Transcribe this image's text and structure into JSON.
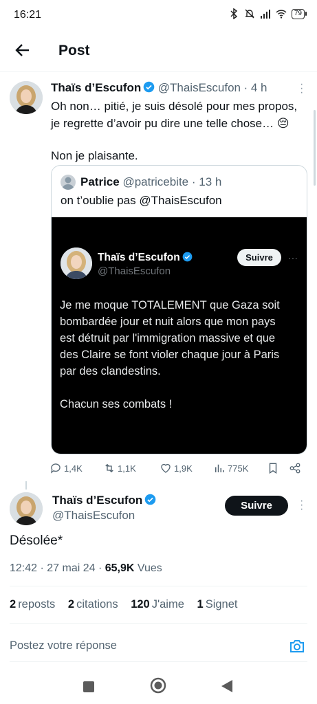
{
  "status_bar": {
    "time": "16:21",
    "battery": "79"
  },
  "header": {
    "title": "Post"
  },
  "reply_tweet": {
    "author_name": "Thaïs d’Escufon",
    "handle": "@ThaisEscufon",
    "time": "· 4 h",
    "text_line1": "Oh non… pitié, je suis désolé pour mes propos,",
    "text_line2": "je regrette d’avoir pu dire une telle chose… 😔",
    "text_line3": "Non je plaisante.",
    "quote": {
      "author_name": "Patrice",
      "handle": "@patricebite",
      "time": "· 13 h",
      "text": "on t’oublie pas @ThaisEscufon",
      "image": {
        "name": "Thaïs d’Escufon",
        "handle": "@ThaisEscufon",
        "follow_label": "Suivre",
        "body_lines": [
          "Je me moque TOTALEMENT que Gaza soit",
          "bombardée jour et nuit alors que mon pays",
          "est détruit par l'immigration massive et que",
          "des Claire se font violer chaque jour à Paris",
          "par des clandestins."
        ],
        "closing": "Chacun ses combats !"
      }
    },
    "actions": {
      "replies": "1,4K",
      "reposts": "1,1K",
      "likes": "1,9K",
      "views": "775K"
    }
  },
  "main_tweet": {
    "author_name": "Thaïs d’Escufon",
    "handle": "@ThaisEscufon",
    "follow_label": "Suivre",
    "text": "Désolée*",
    "timestamp": "12:42 · 27 mai 24 · ",
    "views_count": "65,9K",
    "views_label": " Vues",
    "stats": {
      "reposts_count": "2",
      "reposts_label": "reposts",
      "quotes_count": "2",
      "quotes_label": "citations",
      "likes_count": "120",
      "likes_label": "J'aime",
      "bookmarks_count": "1",
      "bookmarks_label": "Signet"
    }
  },
  "reply_box": {
    "placeholder": "Postez votre réponse"
  },
  "icons": {
    "bluetooth": "bluetooth-icon",
    "mute": "mute-icon",
    "signal": "signal-icon",
    "wifi": "wifi-icon",
    "back": "back-arrow-icon",
    "verified": "verified-badge-icon",
    "reply": "reply-icon",
    "repost": "repost-icon",
    "like": "heart-icon",
    "views": "views-chart-icon",
    "bookmark": "bookmark-icon",
    "share": "share-icon",
    "camera": "camera-icon"
  },
  "colors": {
    "verified": "#1d9bf0",
    "text": "#0f1419",
    "muted": "#536471",
    "accent": "#1d9bf0"
  }
}
